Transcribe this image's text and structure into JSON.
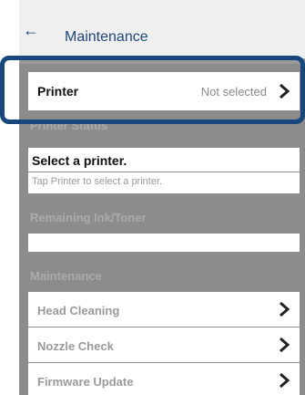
{
  "header": {
    "title": "Maintenance",
    "back_icon": "arrow-left-icon"
  },
  "printer": {
    "label": "Printer",
    "value": "Not selected",
    "chevron_icon": "chevron-right-icon"
  },
  "printer_status": {
    "section_label": "Printer Status",
    "title": "Select a printer.",
    "subtitle": "Tap Printer to select a printer."
  },
  "ink": {
    "section_label": "Remaining Ink/Toner"
  },
  "maintenance": {
    "section_label": "Maintenance",
    "items": [
      {
        "label": "Head Cleaning"
      },
      {
        "label": "Nozzle Check"
      },
      {
        "label": "Firmware Update"
      }
    ]
  },
  "colors": {
    "accent": "#17477c",
    "title_text": "#1f4678",
    "overlay": "#8c8c8c"
  }
}
